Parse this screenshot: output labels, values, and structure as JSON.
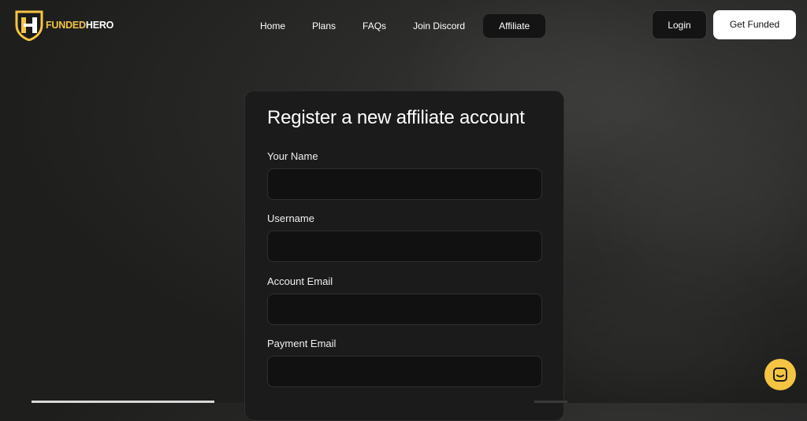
{
  "brand": {
    "name_part1": "FUNDED",
    "name_part2": "HERO"
  },
  "nav": {
    "items": [
      {
        "label": "Home"
      },
      {
        "label": "Plans"
      },
      {
        "label": "FAQs"
      },
      {
        "label": "Join Discord"
      },
      {
        "label": "Affiliate",
        "active": true
      }
    ]
  },
  "header_actions": {
    "login_label": "Login",
    "get_funded_label": "Get Funded"
  },
  "form": {
    "title": "Register a new affiliate account",
    "fields": [
      {
        "label": "Your Name",
        "value": ""
      },
      {
        "label": "Username",
        "value": ""
      },
      {
        "label": "Account Email",
        "value": ""
      },
      {
        "label": "Payment Email",
        "value": ""
      }
    ]
  },
  "icons": {
    "logo": "funded-hero-shield-logo",
    "chat": "chat-support-icon"
  },
  "colors": {
    "accent": "#f4c542",
    "background": "#222221",
    "card": "#1b1b1b",
    "input": "#111111"
  }
}
